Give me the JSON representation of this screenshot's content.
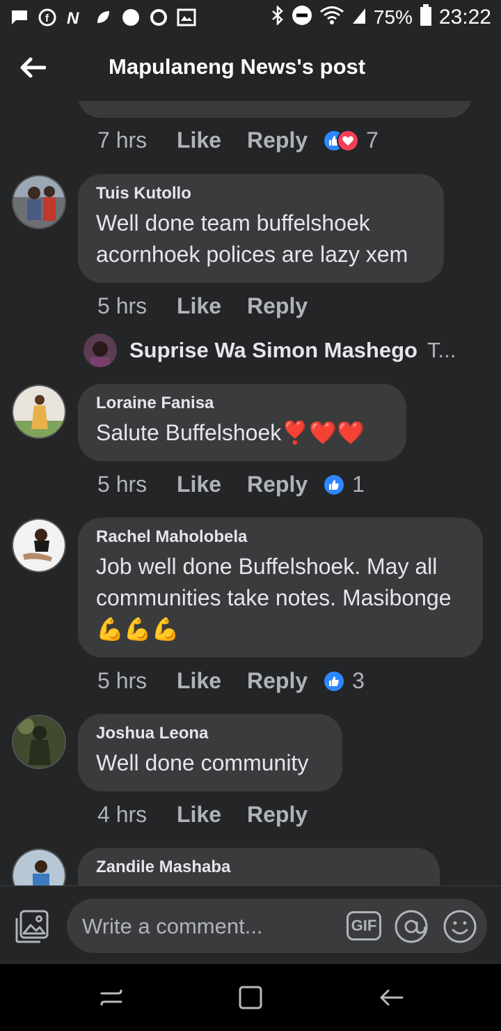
{
  "status_bar": {
    "battery": "75%",
    "time": "23:22"
  },
  "header": {
    "title": "Mapulaneng News's post"
  },
  "top_comment_meta": {
    "time": "7 hrs",
    "like": "Like",
    "reply": "Reply",
    "reaction_count": "7"
  },
  "comments": [
    {
      "author": "Tuis Kutollo",
      "text": "Well done team buffelshoek acornhoek polices are lazy xem",
      "time": "5 hrs",
      "like": "Like",
      "reply": "Reply",
      "reaction_count": ""
    },
    {
      "author": "Loraine Fanisa",
      "text": "Salute Buffelshoek❣️❤️❤️",
      "time": "5 hrs",
      "like": "Like",
      "reply": "Reply",
      "reaction_count": "1"
    },
    {
      "author": "Rachel Maholobela",
      "text": "Job well done Buffelshoek.  May all communities take notes. Masibonge💪💪💪",
      "time": "5 hrs",
      "like": "Like",
      "reply": "Reply",
      "reaction_count": "3"
    },
    {
      "author": "Joshua Leona",
      "text": "Well done community",
      "time": "4 hrs",
      "like": "Like",
      "reply": "Reply",
      "reaction_count": ""
    },
    {
      "author": "Zandile Mashaba",
      "text": ""
    }
  ],
  "reply_preview": {
    "name": "Suprise Wa Simon Mashego",
    "truncated": "T..."
  },
  "composer": {
    "placeholder": "Write a comment...",
    "gif_label": "GIF"
  },
  "colors": {
    "background": "#242526",
    "bubble": "#3a3b3c",
    "like_blue": "#2d88ff",
    "love_red": "#f33e58"
  }
}
